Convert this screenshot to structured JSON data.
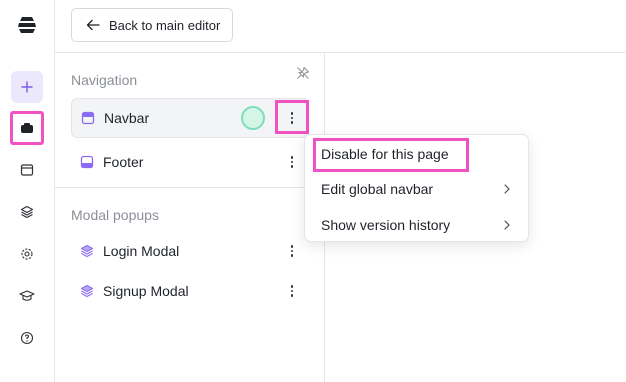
{
  "topbar": {
    "back_label": "Back to main editor"
  },
  "rail": {
    "items": [
      {
        "name": "add",
        "icon": "plus-icon"
      },
      {
        "name": "components",
        "icon": "component-icon"
      },
      {
        "name": "pages",
        "icon": "window-icon"
      },
      {
        "name": "layers",
        "icon": "layers-icon"
      },
      {
        "name": "settings",
        "icon": "gear-icon"
      },
      {
        "name": "learn",
        "icon": "graduation-cap-icon"
      },
      {
        "name": "help",
        "icon": "help-circle-icon"
      }
    ]
  },
  "panel": {
    "navigation": {
      "title": "Navigation",
      "items": [
        {
          "label": "Navbar",
          "icon": "navbar-icon",
          "selected": true
        },
        {
          "label": "Footer",
          "icon": "footer-icon",
          "selected": false
        }
      ]
    },
    "modals": {
      "title": "Modal popups",
      "items": [
        {
          "label": "Login Modal",
          "icon": "layers-icon"
        },
        {
          "label": "Signup Modal",
          "icon": "layers-icon"
        }
      ]
    }
  },
  "context_menu": {
    "items": [
      {
        "label": "Disable for this page",
        "has_submenu": false
      },
      {
        "label": "Edit global navbar",
        "has_submenu": true
      },
      {
        "label": "Show version history",
        "has_submenu": true
      }
    ]
  },
  "colors": {
    "accent": "#7c5ce6",
    "highlight": "#f152c3",
    "cursor": "#7fdcbd"
  }
}
